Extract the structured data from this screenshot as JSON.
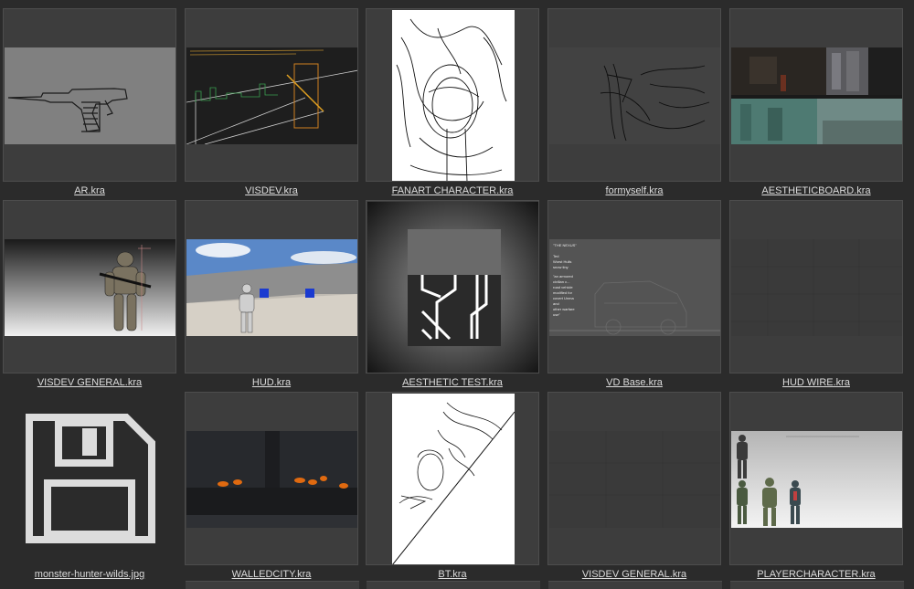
{
  "files": [
    {
      "name": "AR.kra"
    },
    {
      "name": "VISDEV.kra"
    },
    {
      "name": "FANART CHARACTER.kra"
    },
    {
      "name": "formyself.kra"
    },
    {
      "name": "AESTHETICBOARD.kra"
    },
    {
      "name": "VISDEV GENERAL.kra"
    },
    {
      "name": "HUD.kra"
    },
    {
      "name": "AESTHETIC TEST.kra"
    },
    {
      "name": "VD Base.kra"
    },
    {
      "name": "HUD WIRE.kra"
    },
    {
      "name": "monster-hunter-wilds.jpg"
    },
    {
      "name": "WALLEDCITY.kra"
    },
    {
      "name": "BT.kra"
    },
    {
      "name": "VISDEV GENERAL.kra"
    },
    {
      "name": "PLAYERCHARACTER.kra"
    }
  ],
  "thumb_text": {
    "vd_title": "\"THE NEXUS\"",
    "vd_line1": "Ted",
    "vd_line2": "Worst Hulls",
    "vd_line3": "snow tiny",
    "vd_line4": "\"an armored",
    "vd_line5": "civilian c...",
    "vd_line6": "road vehicle",
    "vd_line7": "modified for",
    "vd_line8": "covert Unma",
    "vd_line9": "and",
    "vd_line10": "other warfare",
    "vd_line11": "use\""
  }
}
